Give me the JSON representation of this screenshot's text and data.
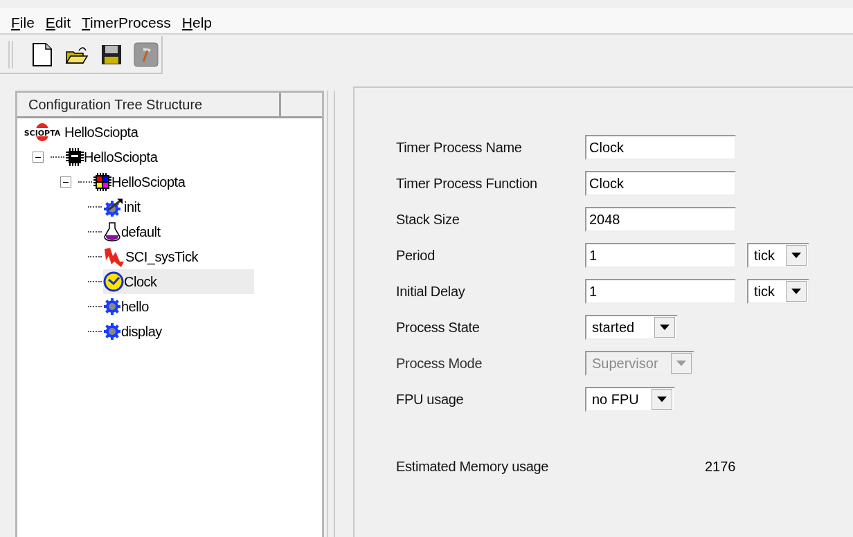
{
  "menu": [
    {
      "label": "File",
      "mnemonic": true
    },
    {
      "label": "Edit",
      "mnemonic": true
    },
    {
      "label": "TimerProcess",
      "mnemonic": true
    },
    {
      "label": "Help",
      "mnemonic": true
    }
  ],
  "toolbar": [
    {
      "kind": "new"
    },
    {
      "kind": "open"
    },
    {
      "kind": "save"
    },
    {
      "kind": "build"
    }
  ],
  "tree": {
    "header": "Configuration Tree Structure",
    "items": [
      {
        "label": "HelloSciopta",
        "kind": "project",
        "logo": "SCIOPTA",
        "selected": false,
        "children": [
          {
            "label": "HelloSciopta",
            "kind": "cpu",
            "selected": false,
            "expanded": true,
            "children": [
              {
                "label": "HelloSciopta",
                "kind": "module",
                "selected": false,
                "expanded": true,
                "children": [
                  {
                    "label": "init",
                    "kind": "init",
                    "selected": false
                  },
                  {
                    "label": "default",
                    "kind": "pool",
                    "selected": false
                  },
                  {
                    "label": "SCI_sysTick",
                    "kind": "interrupt",
                    "selected": false
                  },
                  {
                    "label": "Clock",
                    "kind": "timer",
                    "selected": true
                  },
                  {
                    "label": "hello",
                    "kind": "process",
                    "selected": false
                  },
                  {
                    "label": "display",
                    "kind": "process",
                    "selected": false
                  }
                ]
              }
            ]
          }
        ]
      }
    ]
  },
  "form": {
    "fields": [
      {
        "label": "Timer Process Name",
        "kind": "text",
        "value": "Clock"
      },
      {
        "label": "Timer Process Function",
        "kind": "text",
        "value": "Clock"
      },
      {
        "label": "Stack Size",
        "kind": "text",
        "value": "2048"
      },
      {
        "label": "Period",
        "kind": "text_unit",
        "value": "1",
        "unit": "tick"
      },
      {
        "label": "Initial Delay",
        "kind": "text_unit",
        "value": "1",
        "unit": "tick"
      },
      {
        "label": "Process State",
        "kind": "select",
        "value": "started",
        "disabled": false
      },
      {
        "label": "Process Mode",
        "kind": "select",
        "value": "Supervisor",
        "disabled": true
      },
      {
        "label": "FPU usage",
        "kind": "select",
        "value": "no FPU",
        "disabled": false
      }
    ],
    "memory": {
      "label": "Estimated Memory usage",
      "value": "2176"
    }
  }
}
